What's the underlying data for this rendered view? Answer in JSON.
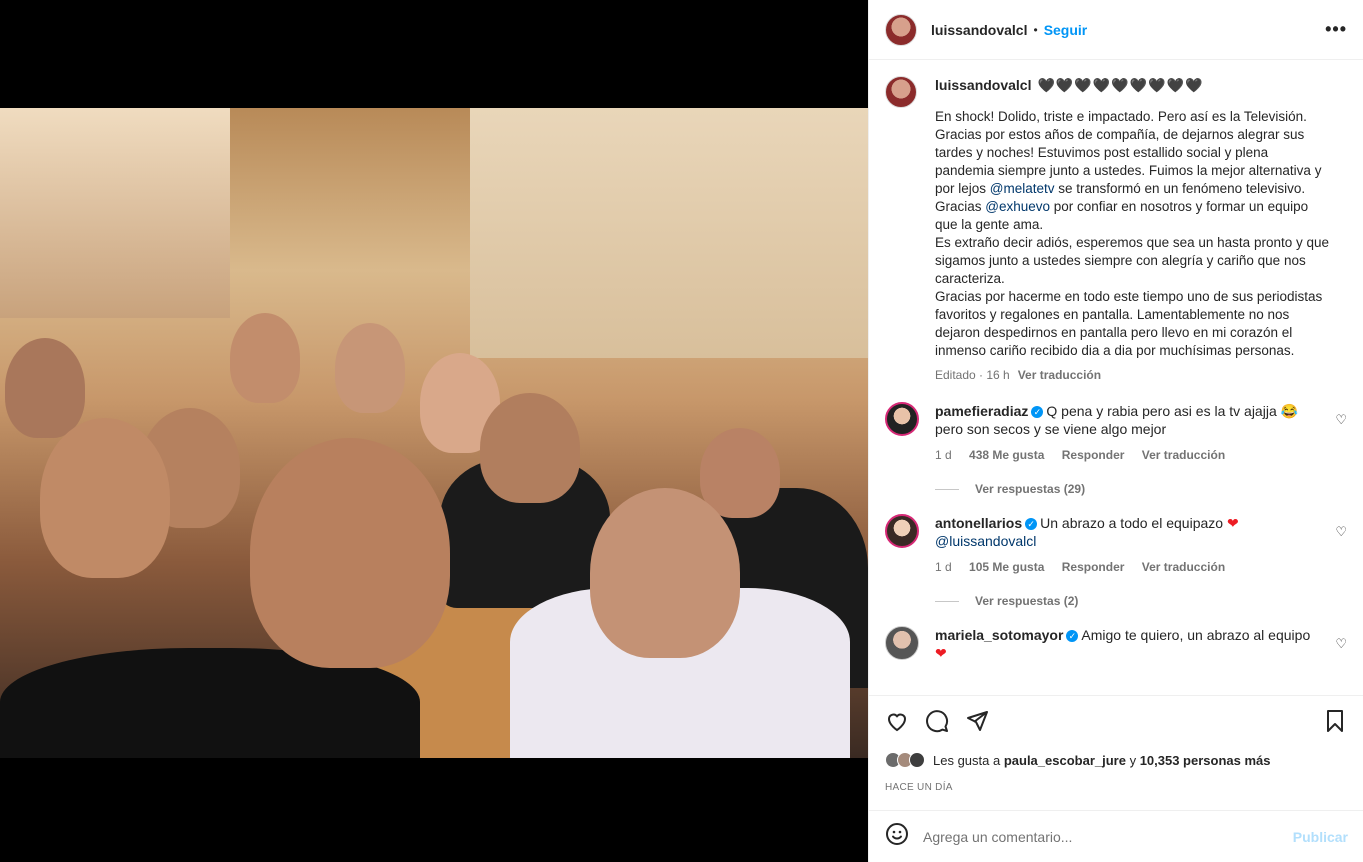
{
  "post": {
    "username": "luissandovalcl",
    "follow_label": "Seguir",
    "separator": "•",
    "more_label": "•••",
    "caption_hearts": "🖤🖤🖤🖤🖤🖤🖤🖤🖤",
    "caption_part1": "En shock! Dolido, triste e impactado. Pero así es la Televisión.\nGracias por estos años de compañía, de dejarnos alegrar sus\ntardes y noches! Estuvimos post estallido social y plena\npandemia siempre junto a ustedes. Fuimos la mejor alternativa y\npor lejos ",
    "mention1": "@melatetv",
    "caption_part2": " se transformó en un fenómeno televisivo.\nGracias ",
    "mention2": "@exhuevo",
    "caption_part3": " por confiar en nosotros y formar un equipo\nque la gente ama.\nEs extraño decir adiós, esperemos que sea un hasta pronto y que\nsigamos junto a ustedes siempre con alegría y cariño que nos\ncaracteriza.\nGracias por hacerme en todo este tiempo uno de sus periodistas\nfavoritos y regalones en pantalla. Lamentablemente no nos\ndejaron despedirnos en pantalla pero llevo en mi corazón el\ninmenso cariño recibido dia a dia por muchísimas personas.",
    "edited": "Editado · 16 h",
    "translate": "Ver traducción"
  },
  "comments": [
    {
      "user": "pamefieradiaz",
      "verified": true,
      "text": "Q pena y rabia pero asi es la tv ajajja 😂 pero son secos y se viene algo mejor",
      "time": "1 d",
      "likes": "438 Me gusta",
      "reply": "Responder",
      "translate": "Ver traducción",
      "replies": "Ver respuestas (29)"
    },
    {
      "user": "antonellarios",
      "verified": true,
      "text": "Un abrazo a todo el equipazo ",
      "heart": "❤",
      "mention": "@luissandovalcl",
      "time": "1 d",
      "likes": "105 Me gusta",
      "reply": "Responder",
      "translate": "Ver traducción",
      "replies": "Ver respuestas (2)"
    },
    {
      "user": "mariela_sotomayor",
      "verified": true,
      "text": "Amigo te quiero, un abrazo al equipo",
      "heart": "❤"
    }
  ],
  "actions": {
    "like_icon": "heart-outline-icon",
    "comment_icon": "comment-icon",
    "share_icon": "send-icon",
    "save_icon": "bookmark-icon"
  },
  "likes": {
    "prefix": "Les gusta a ",
    "user": "paula_escobar_jure",
    "middle": " y ",
    "others": "10,353 personas más"
  },
  "timestamp": "HACE UN DÍA",
  "add_comment": {
    "placeholder": "Agrega un comentario...",
    "publish": "Publicar"
  }
}
